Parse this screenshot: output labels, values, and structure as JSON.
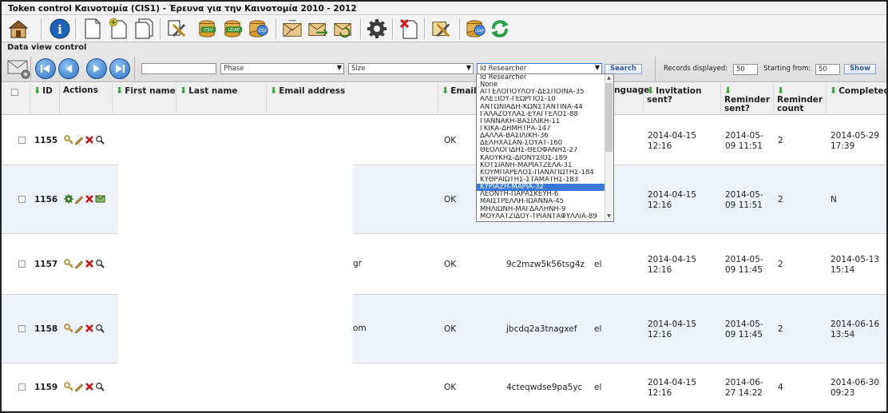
{
  "window": {
    "title": "Token control Καινοτομία (CIS1) - Έρευνα για την Καινοτομία 2010 - 2012"
  },
  "toolbar": {
    "icons": [
      "home-icon",
      "info-icon",
      "new-document-icon",
      "add-document-icon",
      "copy-document-icon",
      "tools-icon",
      "csv-import-icon",
      "ldap-import-icon",
      "csv-export-icon",
      "invite-mail-icon",
      "remind-mail-icon",
      "refresh-mail-icon",
      "settings-gear-icon",
      "delete-document-icon",
      "manage-tools-icon",
      "ldap-export-icon",
      "sync-icon"
    ]
  },
  "dataview": {
    "title": "Data view control",
    "search_input": "",
    "phase_select": "Phase",
    "size_select": "Size",
    "researcher_select": "Id Researcher",
    "search_button": "Search",
    "records_label": "Records displayed:",
    "records_value": "50",
    "starting_label": "Starting from:",
    "starting_value": "50",
    "show_button": "Show"
  },
  "dropdown": {
    "options": [
      "Id Researcher",
      "None",
      "ΑΓΓΕΛΟΠΟΥΛΟΥ-ΔΕΣΠΟΙΝΑ-35",
      "ΑΛΕΞΙΟΥ-ΓΕΩΡΓΙΟΣ-10",
      "ΑΝΤΩΝΙΑΔΗ-ΚΩΝΣΤΑΝΤΙΝΑ-44",
      "ΓΑΛΑΖΟΥΛΑΣ-ΕΥΑΓΓΕΛΟΣ-88",
      "ΓΙΑΝΝΑΚΗ-ΒΑΣΙΛΙΚΗ-11",
      "ΓΚΙΚΑ-ΔΗΜΗΤΡΑ-147",
      "ΔΑΛΛΑ-ΒΑΣΙΛΙΚΗ-36",
      "ΔΕΛΗΧΑΣΑΝ-ΣΟΥΑΤ-160",
      "ΘΕΟΛΟΓΙΔΗΣ-ΘΕΟΦΑΝΗΣ-27",
      "ΚΑΟΥΚΗΣ-ΔΙΟΝΥΣΙΟΣ-189",
      "ΚΟΤΣΙΑΝΗ-ΜΑΡΙΑΤΖΕΛΑ-31",
      "ΚΟΥΜΠΑΡΕΛΟΣ-ΠΑΝΑΓΙΩΤΗΣ-184",
      "ΚΥΘΡΑΙΩΤΗΣ-ΣΤΑΜΑΤΗΣ-183",
      "ΚΥΡΙΑΖΗ-ΜΑΡΙΑ-32",
      "ΛΕΟΝΤΗ-ΠΑΡΑΣΚΕΥΗ-6",
      "ΜΑΙΣΤΡΕΛΛΗ-ΙΩΑΝΝΑ-45",
      "ΜΗΛΙΩΝΗ-ΜΑΓΔΑΛΗΝΗ-9",
      "ΜΟΥΛΑΤΖΙΔΟΥ-ΤΡΙΑΝΤΑΦΥΛΛΙΑ-89"
    ],
    "selected_index": 15
  },
  "table": {
    "headers": {
      "id": "ID",
      "actions": "Actions",
      "first_name": "First name",
      "last_name": "Last name",
      "email": "Email address",
      "email_status": "Email",
      "language": "anguage",
      "invitation": "Invitation sent?",
      "reminder_sent_1": "Reminder",
      "reminder_sent_2": "sent?",
      "reminder_count_1": "Reminder",
      "reminder_count_2": "count",
      "completed": "Completed?"
    },
    "rows": [
      {
        "id": "1155",
        "email_tail": "",
        "status": "OK",
        "token": "",
        "lang": "",
        "inv_1": "2014-04-15",
        "inv_2": "12:16",
        "rem_1": "2014-05-",
        "rem_2": "09 11:51",
        "count": "2",
        "comp_1": "2014-05-29",
        "comp_2": "17:39",
        "actions": [
          "key-icon",
          "pencil-icon",
          "delete-x-icon",
          "magnifier-icon"
        ]
      },
      {
        "id": "1156",
        "email_tail": "",
        "status": "OK",
        "token": "",
        "lang": "",
        "inv_1": "2014-04-15",
        "inv_2": "12:16",
        "rem_1": "2014-05-",
        "rem_2": "09 11:51",
        "count": "2",
        "comp_1": "N",
        "comp_2": "",
        "actions": [
          "gear-icon",
          "pencil-icon",
          "delete-x-icon",
          "mail-icon"
        ]
      },
      {
        "id": "1157",
        "email_tail": "gr",
        "status": "OK",
        "token": "9c2mzw5k56tsg4z",
        "lang": "el",
        "inv_1": "2014-04-15",
        "inv_2": "12:16",
        "rem_1": "2014-05-",
        "rem_2": "09 11:45",
        "count": "2",
        "comp_1": "2014-05-13",
        "comp_2": "15:14",
        "actions": [
          "key-icon",
          "pencil-icon",
          "delete-x-icon",
          "magnifier-icon"
        ]
      },
      {
        "id": "1158",
        "email_tail": "om",
        "status": "OK",
        "token": "jbcdq2a3tnagxef",
        "lang": "el",
        "inv_1": "2014-04-15",
        "inv_2": "12:16",
        "rem_1": "2014-05-",
        "rem_2": "09 11:45",
        "count": "2",
        "comp_1": "2014-06-16",
        "comp_2": "13:54",
        "actions": [
          "key-icon",
          "pencil-icon",
          "delete-x-icon",
          "magnifier-icon"
        ]
      },
      {
        "id": "1159",
        "email_tail": "",
        "status": "OK",
        "token": "4cteqwdse9pa5yc",
        "lang": "el",
        "inv_1": "2014-04-15",
        "inv_2": "12:16",
        "rem_1": "2014-06-",
        "rem_2": "27 14:22",
        "count": "4",
        "comp_1": "2014-06-30",
        "comp_2": "09:23",
        "actions": [
          "key-icon",
          "pencil-icon",
          "delete-x-icon",
          "magnifier-icon"
        ]
      }
    ]
  },
  "colors": {
    "accent": "#3b78d8",
    "green_arrow": "#37a537",
    "row_alt": "#eef3fa"
  }
}
